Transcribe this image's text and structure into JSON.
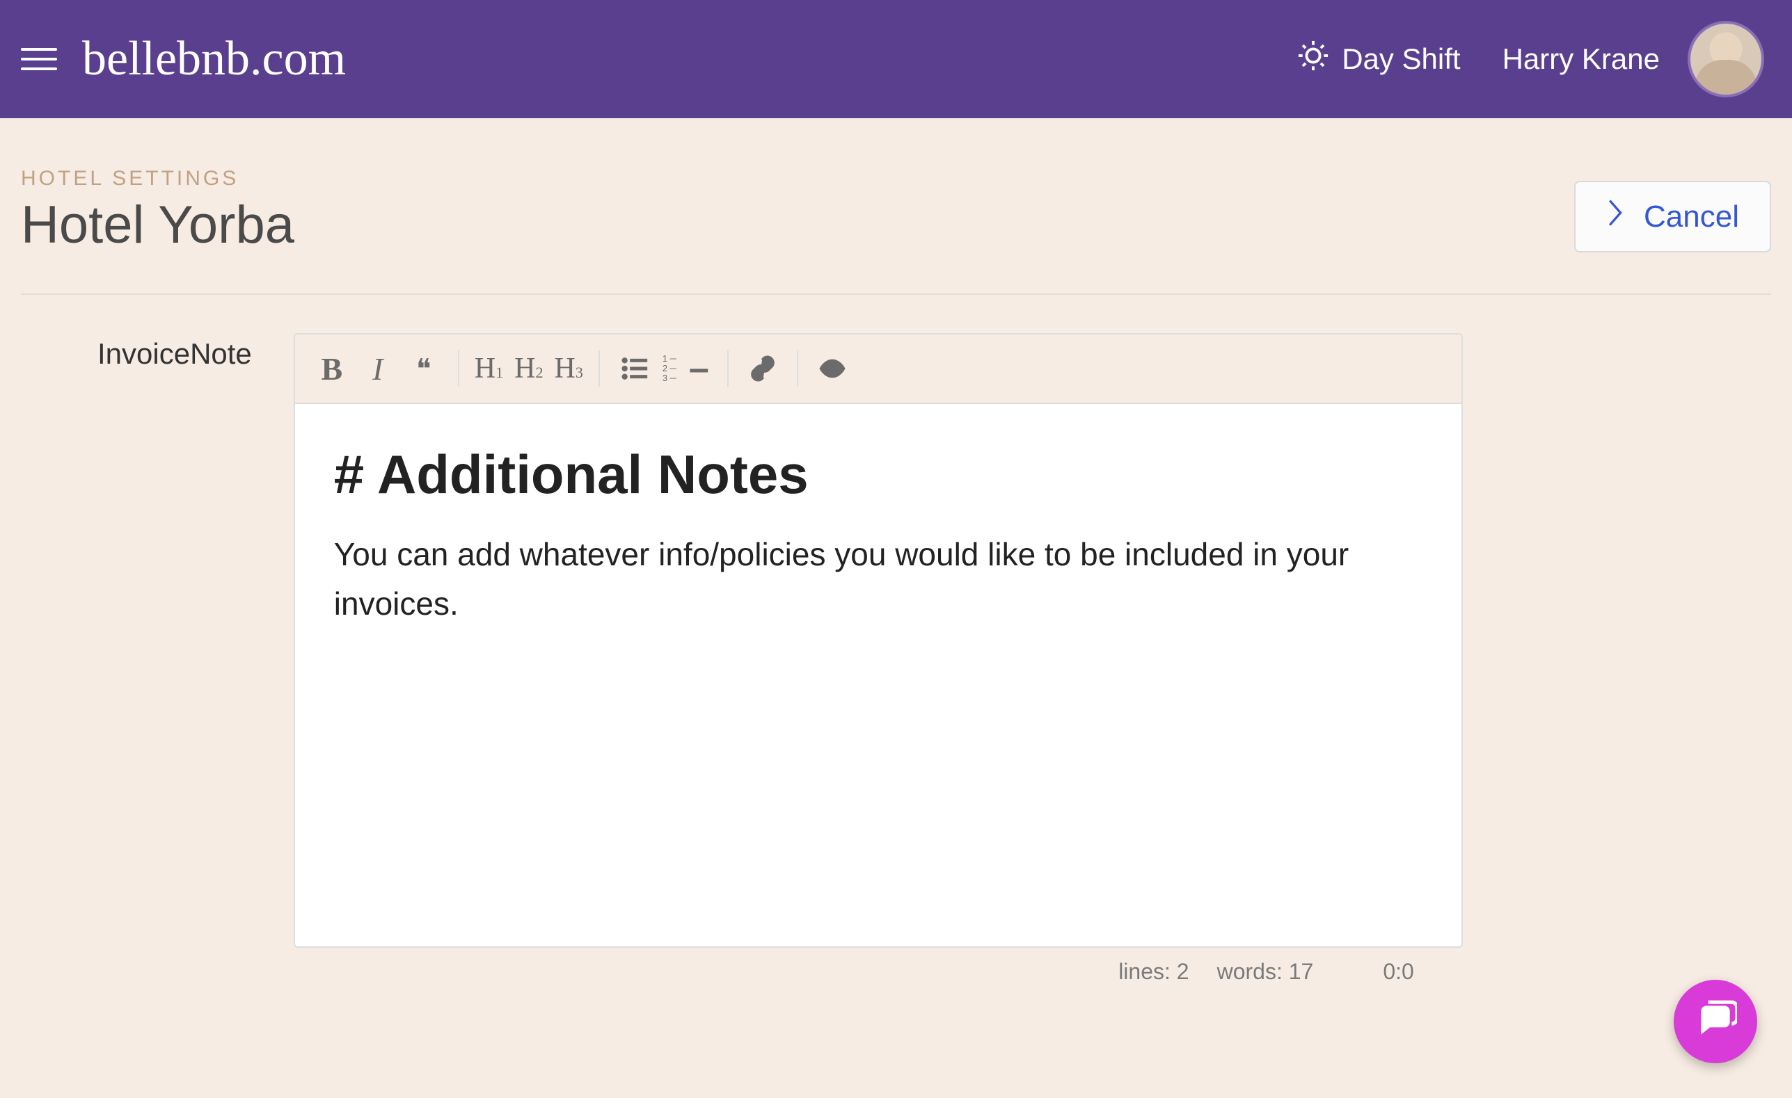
{
  "colors": {
    "brand": "#5a3f8f",
    "accent": "#3457d6",
    "fab": "#d83bd8"
  },
  "navbar": {
    "brand": "bellebnb.com",
    "shift_label": "Day Shift",
    "user_name": "Harry Krane"
  },
  "header": {
    "breadcrumb": "HOTEL SETTINGS",
    "title": "Hotel Yorba",
    "cancel_label": "Cancel"
  },
  "form": {
    "field_label": "InvoiceNote"
  },
  "editor": {
    "toolbar": {
      "bold": "B",
      "italic": "I",
      "quote": "❝",
      "h1_label": "H",
      "h1_sub": "1",
      "h2_label": "H",
      "h2_sub": "2",
      "h3_label": "H",
      "h3_sub": "3",
      "ol_glyph": "1 ─\n2 ─\n3 ─",
      "hr_glyph": "–"
    },
    "content": {
      "heading": "# Additional Notes",
      "paragraph": "You can add whatever info/policies you would like to be included in your invoices."
    },
    "status": {
      "lines_label": "lines:",
      "lines_value": "2",
      "words_label": "words:",
      "words_value": "17",
      "cursor_pos": "0:0"
    }
  }
}
